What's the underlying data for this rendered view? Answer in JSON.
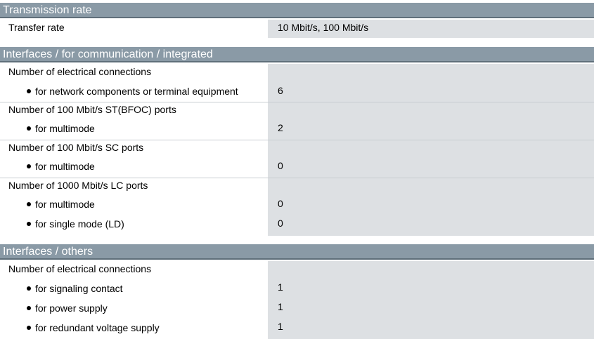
{
  "sections": [
    {
      "title": "Transmission rate"
    },
    {
      "title": "Interfaces / for communication / integrated"
    },
    {
      "title": "Interfaces / others"
    }
  ],
  "rows": {
    "transfer_rate": {
      "label": "Transfer rate",
      "value": "10 Mbit/s, 100 Mbit/s"
    },
    "elec_conn_1": {
      "label": "Number of electrical connections"
    },
    "network_components": {
      "label": "for network components or terminal equipment",
      "value": "6"
    },
    "st_bfoc": {
      "label": "Number of 100 Mbit/s ST(BFOC) ports"
    },
    "st_multimode": {
      "label": "for multimode",
      "value": "2"
    },
    "sc_ports": {
      "label": "Number of 100 Mbit/s SC ports"
    },
    "sc_multimode": {
      "label": "for multimode",
      "value": "0"
    },
    "lc_ports": {
      "label": "Number of 1000 Mbit/s LC ports"
    },
    "lc_multimode": {
      "label": "for multimode",
      "value": "0"
    },
    "lc_singlemode": {
      "label": "for single mode (LD)",
      "value": "0"
    },
    "elec_conn_2": {
      "label": "Number of electrical connections"
    },
    "signaling": {
      "label": "for signaling contact",
      "value": "1"
    },
    "power": {
      "label": "for power supply",
      "value": "1"
    },
    "redundant": {
      "label": "for redundant voltage supply",
      "value": "1"
    }
  }
}
